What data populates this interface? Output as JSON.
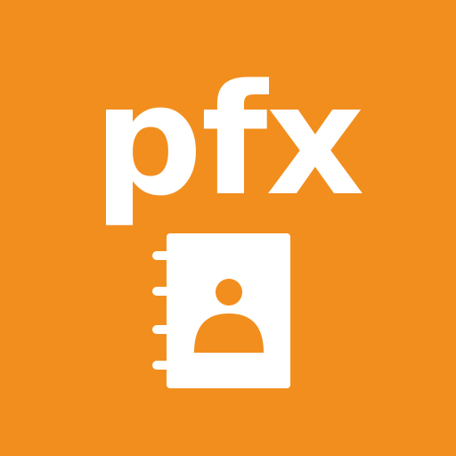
{
  "tile": {
    "label": "pfx",
    "background_color": "#F28E1E",
    "foreground_color": "#FFFFFF"
  },
  "icon": {
    "name": "contact-book-icon"
  }
}
